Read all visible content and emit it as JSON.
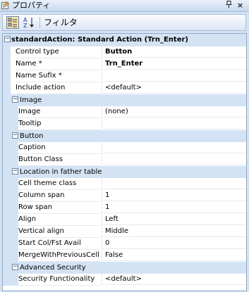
{
  "window": {
    "title": "プロパティ",
    "pin_glyph": "ꟷ",
    "close_glyph": "×"
  },
  "toolbar": {
    "filter_label": "フィルタ"
  },
  "object": {
    "header": "standardAction: Standard Action (Trn_Enter)"
  },
  "top_properties": [
    {
      "name": "Control type",
      "value": "Button",
      "bold": true
    },
    {
      "name": "Name *",
      "value": "Trn_Enter",
      "bold": true
    },
    {
      "name": "Name Sufix *",
      "value": "",
      "bold": false
    },
    {
      "name": "Include action",
      "value": "<default>",
      "bold": false
    }
  ],
  "categories": [
    {
      "label": "Image",
      "properties": [
        {
          "name": "Image",
          "value": "(none)"
        },
        {
          "name": "Tooltip",
          "value": ""
        }
      ]
    },
    {
      "label": "Button",
      "properties": [
        {
          "name": "Caption",
          "value": ""
        },
        {
          "name": "Button Class",
          "value": ""
        }
      ]
    },
    {
      "label": "Location in father table",
      "properties": [
        {
          "name": "Cell theme class",
          "value": ""
        },
        {
          "name": "Column span",
          "value": "1"
        },
        {
          "name": "Row span",
          "value": "1"
        },
        {
          "name": "Align",
          "value": "Left"
        },
        {
          "name": "Vertical align",
          "value": "Middle"
        },
        {
          "name": "Start Col/Fst Avail",
          "value": "0"
        },
        {
          "name": "MergeWithPreviousCell",
          "value": "False"
        }
      ]
    },
    {
      "label": "Advanced Security",
      "properties": [
        {
          "name": "Security Functionality",
          "value": "<default>"
        }
      ]
    }
  ],
  "collapse_glyph": "−"
}
